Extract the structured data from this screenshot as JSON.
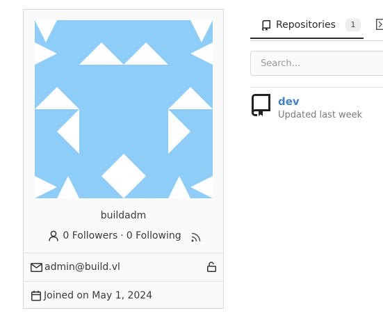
{
  "profile": {
    "username": "buildadm",
    "followers_label": "0 Followers",
    "separator": "·",
    "following_label": "0 Following",
    "email": "admin@build.vl",
    "joined": "Joined on May 1, 2024",
    "avatar_colors": {
      "background": "#ffffff",
      "pattern": "#8ecdf8"
    }
  },
  "tabs": {
    "repositories_label": "Repositories",
    "repositories_count": "1"
  },
  "search": {
    "placeholder": "Search…"
  },
  "repos": [
    {
      "name": "dev",
      "updated": "Updated last week"
    }
  ],
  "colors": {
    "link": "#4183c4",
    "muted": "#7a7a7a"
  },
  "icons": [
    "person-icon",
    "rss-icon",
    "mail-icon",
    "lock-icon",
    "calendar-icon",
    "repo-icon",
    "package-icon"
  ]
}
